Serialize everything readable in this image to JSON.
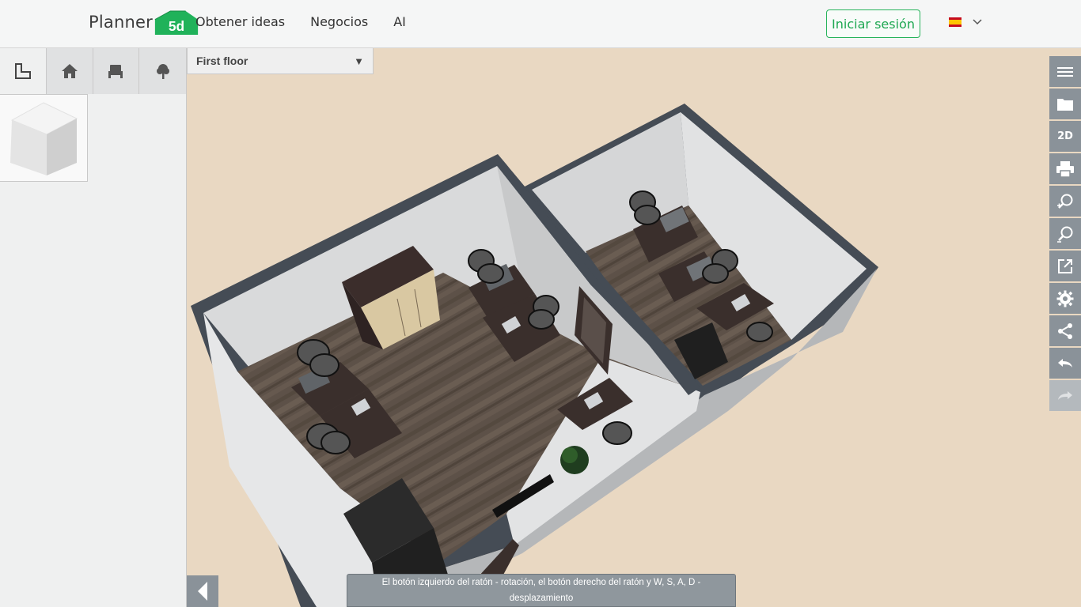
{
  "brand": {
    "name": "Planner",
    "badge": "5d"
  },
  "nav": {
    "items": [
      "Obtener ideas",
      "Negocios",
      "AI"
    ]
  },
  "header": {
    "login_label": "Iniciar sesión"
  },
  "language": {
    "flag": "spain-flag-icon"
  },
  "left_tabs": [
    {
      "name": "floor-plan-icon"
    },
    {
      "name": "house-icon"
    },
    {
      "name": "furniture-icon"
    },
    {
      "name": "tree-icon"
    }
  ],
  "floor_selector": {
    "value": "First floor"
  },
  "right_toolbar": [
    {
      "name": "menu-icon"
    },
    {
      "name": "folder-icon"
    },
    {
      "name": "view-2d-button",
      "label": "2D"
    },
    {
      "name": "print-icon"
    },
    {
      "name": "zoom-in-icon"
    },
    {
      "name": "zoom-out-icon"
    },
    {
      "name": "external-link-icon"
    },
    {
      "name": "settings-icon"
    },
    {
      "name": "share-icon"
    },
    {
      "name": "undo-icon"
    },
    {
      "name": "redo-icon"
    }
  ],
  "hint": {
    "text": "El botón izquierdo del ratón - rotación, el botón derecho del ratón y W, S, A, D - desplazamiento"
  },
  "colors": {
    "accent": "#1da751",
    "canvas_bg": "#e9d8c2",
    "toolbar": "#8a9299"
  }
}
